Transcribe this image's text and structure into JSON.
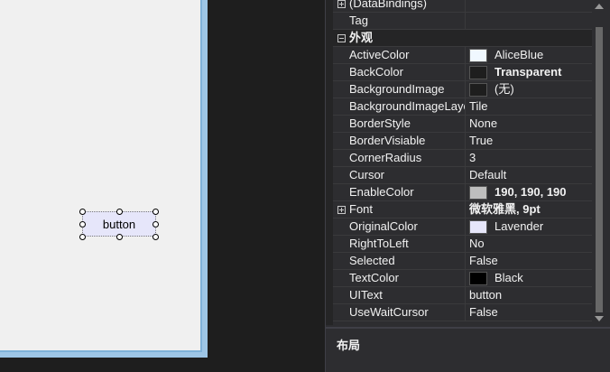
{
  "designer": {
    "button_text": "button",
    "button_color": "#e6e6fa"
  },
  "properties": [
    {
      "name": "(DataBindings)",
      "value": "",
      "expander": "plus"
    },
    {
      "name": "Tag",
      "value": ""
    },
    {
      "name": "外观",
      "category": true,
      "expander": "minus"
    },
    {
      "name": "ActiveColor",
      "value": "AliceBlue",
      "swatch": "#f0f8ff"
    },
    {
      "name": "BackColor",
      "value": "Transparent",
      "swatch": "#1e1e1e",
      "bold": true
    },
    {
      "name": "BackgroundImage",
      "value": "(无)",
      "swatch": "#1e1e1e"
    },
    {
      "name": "BackgroundImageLayout",
      "value": "Tile"
    },
    {
      "name": "BorderStyle",
      "value": "None"
    },
    {
      "name": "BorderVisiable",
      "value": "True"
    },
    {
      "name": "CornerRadius",
      "value": "3"
    },
    {
      "name": "Cursor",
      "value": "Default"
    },
    {
      "name": "EnableColor",
      "value": "190, 190, 190",
      "swatch": "#bebebe",
      "bold": true
    },
    {
      "name": "Font",
      "value": "微软雅黑, 9pt",
      "expander": "plus",
      "bold": true
    },
    {
      "name": "OriginalColor",
      "value": "Lavender",
      "swatch": "#e6e6fa"
    },
    {
      "name": "RightToLeft",
      "value": "No"
    },
    {
      "name": "Selected",
      "value": "False"
    },
    {
      "name": "TextColor",
      "value": "Black",
      "swatch": "#000000"
    },
    {
      "name": "UIText",
      "value": "button"
    },
    {
      "name": "UseWaitCursor",
      "value": "False"
    }
  ],
  "description": {
    "title": "布局"
  }
}
